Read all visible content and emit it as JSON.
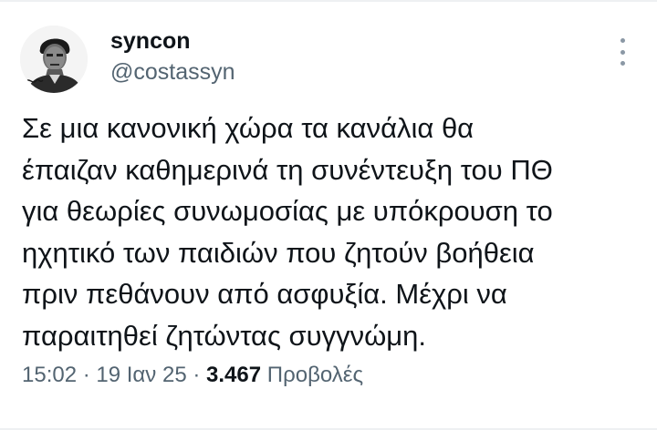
{
  "author": {
    "display_name": "syncon",
    "handle": "@costassyn",
    "avatar_icon": "portrait-avatar"
  },
  "tweet": {
    "lines": [
      "Σε μια κανονική χώρα τα κανάλια θα",
      "έπαιζαν καθημερινά τη συνέντευξη του ΠΘ",
      "για θεωρίες συνωμοσίας με υπόκρουση το",
      "ηχητικό των παιδιών που ζητούν βοήθεια",
      "πριν πεθάνουν από ασφυξία. Μέχρι να",
      "παραιτηθεί ζητώντας συγγνώμη."
    ]
  },
  "meta": {
    "time": "15:02",
    "separator": " · ",
    "date": "19 Ιαν 25",
    "views_count": "3.467",
    "views_label": "Προβολές"
  },
  "icons": {
    "more": "more-vertical-icon"
  },
  "colors": {
    "text_primary": "#0f1419",
    "text_secondary": "#536471",
    "icon_gray": "#8b98a5"
  }
}
